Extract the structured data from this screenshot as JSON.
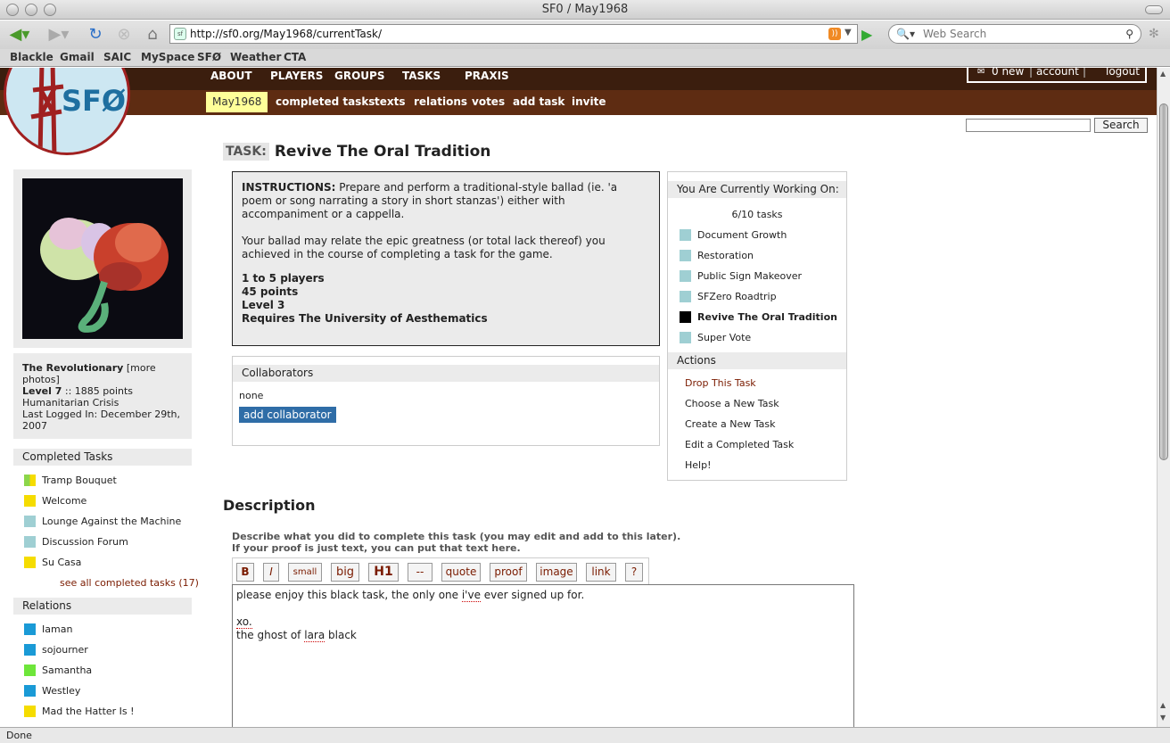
{
  "window": {
    "title": "SF0 / May1968"
  },
  "browser": {
    "url": "http://sf0.org/May1968/currentTask/",
    "search_placeholder": "Web Search",
    "bookmarks": [
      "Blackle",
      "Gmail",
      "SAIC",
      "MySpace",
      "SFØ",
      "Weather",
      "CTA"
    ],
    "status": "Done"
  },
  "site": {
    "logo_text": "SFØ",
    "topnav": [
      "ABOUT",
      "PLAYERS",
      "GROUPS",
      "TASKS",
      "PRAXIS"
    ],
    "user": {
      "new_msgs": "0 new",
      "account": "account",
      "logout": "logout"
    },
    "subnav_active": "May1968",
    "subnav": [
      "completed tasks",
      "texts",
      "relations",
      "votes",
      "add task",
      "invite"
    ],
    "search_button": "Search"
  },
  "profile": {
    "name": "The Revolutionary",
    "more_photos": "[more photos]",
    "level": "Level 7",
    "points": ":: 1885 points",
    "house": "Humanitarian Crisis",
    "last_logged": "Last Logged In: December 29th, 2007"
  },
  "completed": {
    "heading": "Completed Tasks",
    "items": [
      "Tramp Bouquet",
      "Welcome",
      "Lounge Against the Machine",
      "Discussion Forum",
      "Su Casa"
    ],
    "see_all": "see all completed tasks (17)"
  },
  "relations": {
    "heading": "Relations",
    "items": [
      "Iaman",
      "sojourner",
      "Samantha",
      "Westley",
      "Mad the Hatter Is !"
    ]
  },
  "task": {
    "label": "TASK:",
    "name": "Revive The Oral Tradition",
    "instructions_label": "INSTRUCTIONS:",
    "instructions": "Prepare and perform a traditional-style ballad (ie. 'a poem or song narrating a story in short stanzas') either with accompaniment or a cappella.",
    "instructions_2": "Your ballad may relate the epic greatness (or total lack thereof) you achieved in the course of completing a task for the game.",
    "players": "1 to 5 players",
    "points": "45 points",
    "level": "Level 3",
    "requires": "Requires The University of Aesthematics"
  },
  "collaborators": {
    "heading": "Collaborators",
    "none": "none",
    "add": "add collaborator"
  },
  "working": {
    "heading": "You Are Currently Working On:",
    "count": "6/10 tasks",
    "items": [
      "Document Growth",
      "Restoration",
      "Public Sign Makeover",
      "SFZero Roadtrip",
      "Revive The Oral Tradition",
      "Super Vote"
    ],
    "actions_heading": "Actions",
    "actions": [
      "Drop This Task",
      "Choose a New Task",
      "Create a New Task",
      "Edit a Completed Task",
      "Help!"
    ]
  },
  "description": {
    "heading": "Description",
    "help1": "Describe what you did to complete this task (you may edit and add to this later).",
    "help2": "If your proof is just text, you can put that text here.",
    "toolbar": [
      "B",
      "I",
      "small",
      "big",
      "H1",
      "--",
      "quote",
      "proof",
      "image",
      "link",
      "?"
    ],
    "line1_a": "please enjoy this black task, the only one ",
    "line1_b": "i've",
    "line1_c": " ever signed up for.",
    "line2": "xo.",
    "line3_a": "the ghost of ",
    "line3_b": "lara",
    "line3_c": " black"
  },
  "colors": {
    "topnav": "#3b1e0e",
    "subnav": "#5e2c12",
    "active": "#ffff99",
    "link": "#7a1b00",
    "button": "#2f6da7"
  }
}
